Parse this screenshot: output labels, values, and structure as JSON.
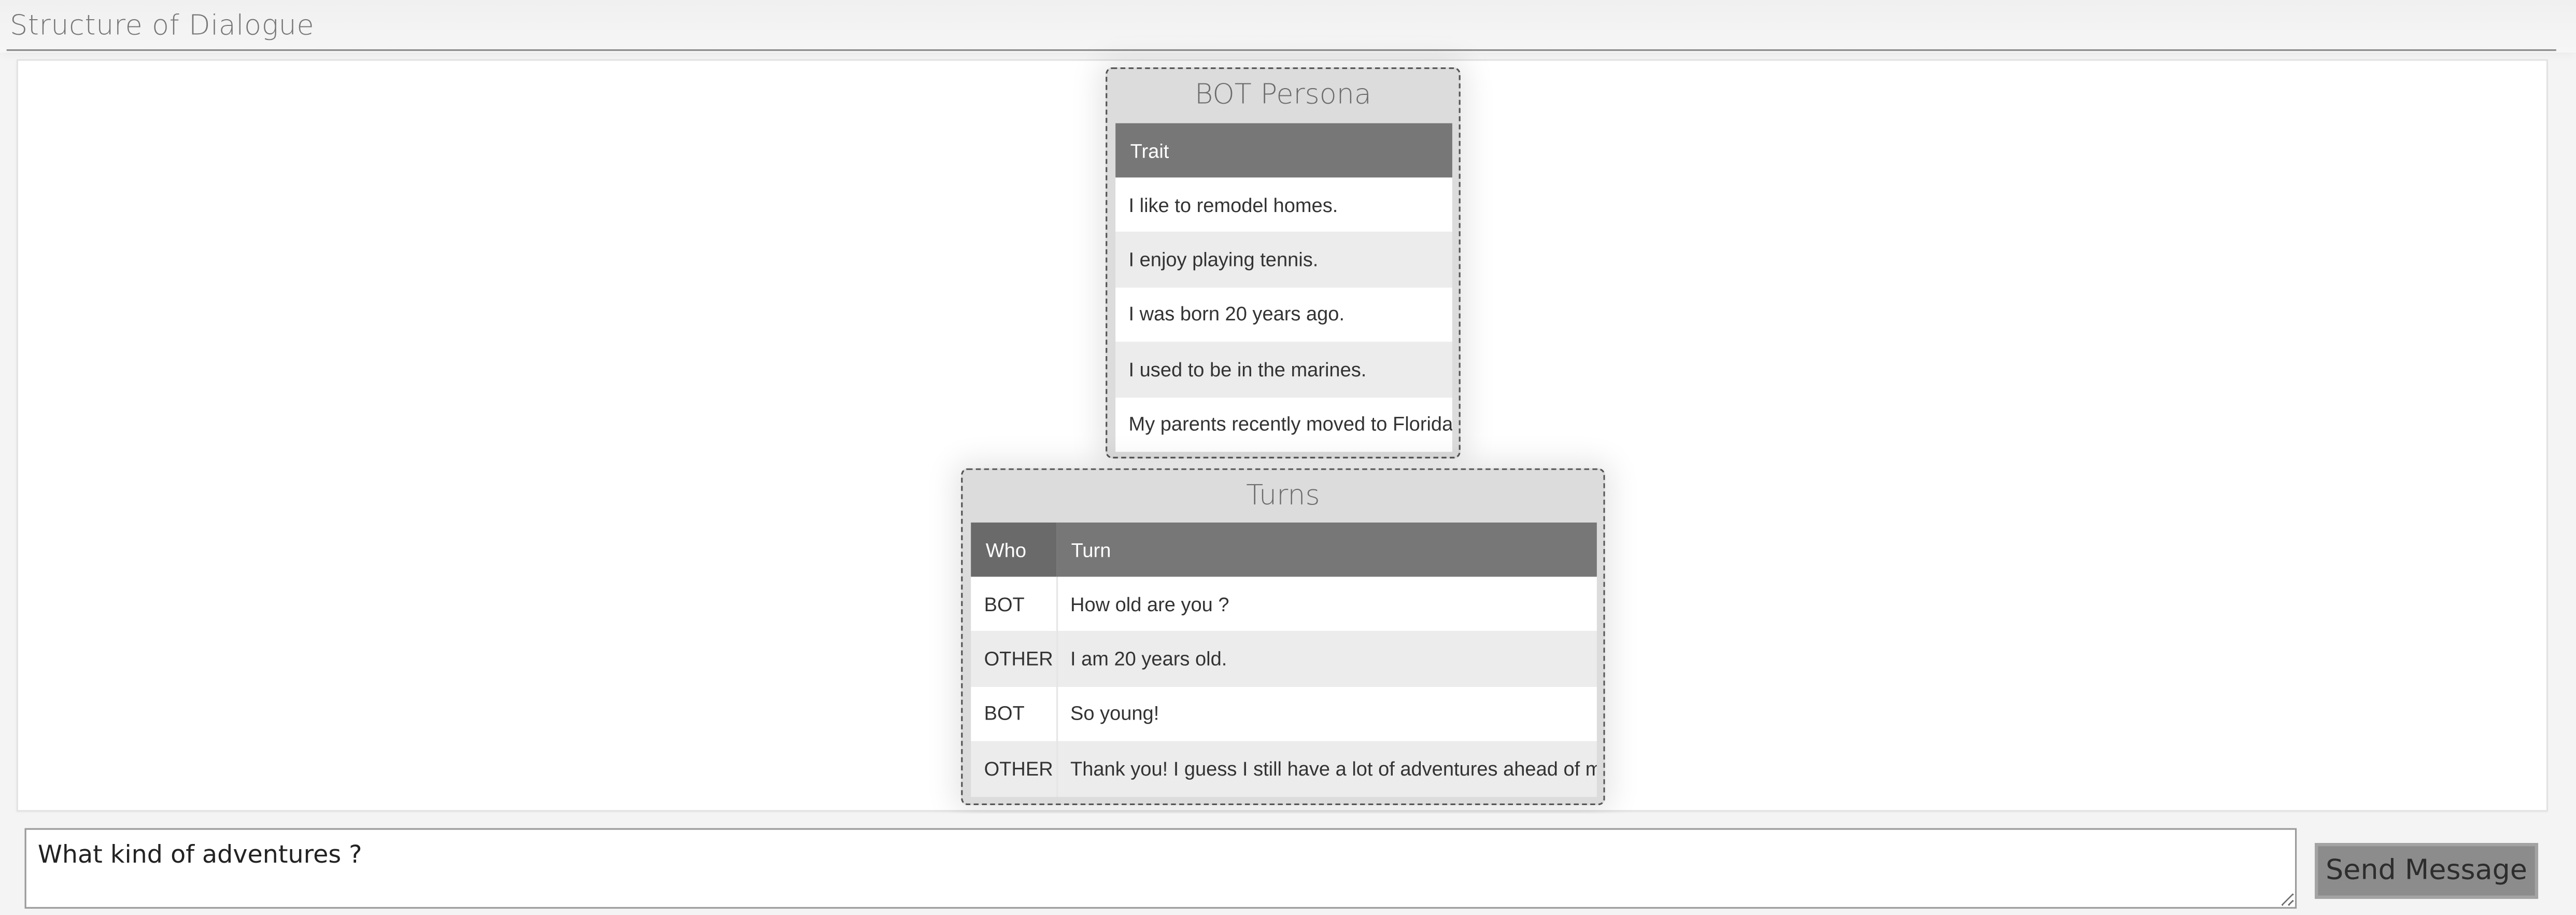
{
  "page": {
    "title": "Structure of Dialogue"
  },
  "persona": {
    "title": "BOT Persona",
    "header": "Trait",
    "traits": [
      "I like to remodel homes.",
      "I enjoy playing tennis.",
      "I was born 20 years ago.",
      "I used to be in the marines.",
      "My parents recently moved to Florida."
    ]
  },
  "turns": {
    "title": "Turns",
    "headers": {
      "who": "Who",
      "turn": "Turn"
    },
    "rows": [
      {
        "who": "BOT",
        "turn": "How old are you ?"
      },
      {
        "who": "OTHER",
        "turn": "I am 20 years old."
      },
      {
        "who": "BOT",
        "turn": "So young!"
      },
      {
        "who": "OTHER",
        "turn": "Thank you! I guess I still have a lot of adventures ahead of me."
      }
    ]
  },
  "composer": {
    "input_value": "What kind of adventures ?",
    "send_label": "Send Message"
  }
}
